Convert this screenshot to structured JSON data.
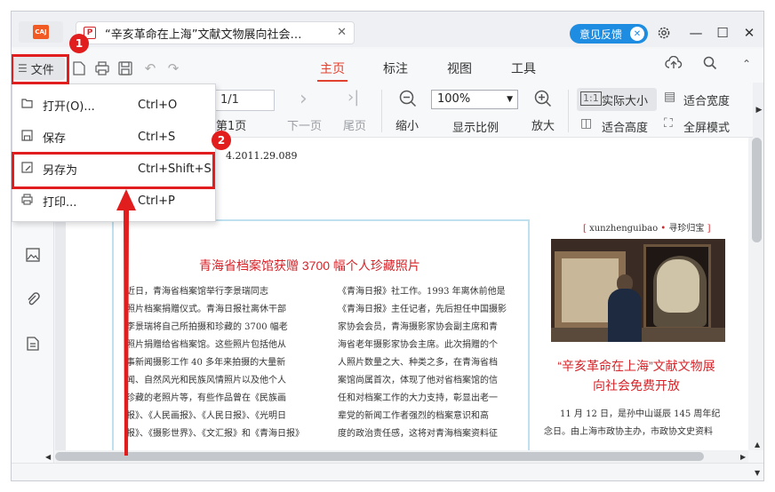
{
  "app": {
    "logo_text": "CAJ",
    "tab_icon": "pdf-icon",
    "tab_title": "“辛亥革命在上海”文献文物展向社会…",
    "tab_close": "✕"
  },
  "titlebar": {
    "feedback": "意见反馈",
    "feedback_close": "✕",
    "settings_icon": "gear-icon",
    "minimize": "—",
    "maximize": "☐",
    "close": "✕"
  },
  "menubar": {
    "file_label": "文件",
    "tabs": [
      {
        "label": "主页",
        "active": true
      },
      {
        "label": "标注"
      },
      {
        "label": "视图"
      },
      {
        "label": "工具"
      }
    ],
    "right_icons": [
      "cloud-upload-icon",
      "search-icon",
      "chevron-up-icon"
    ]
  },
  "ribbon": {
    "page_input": "1/1",
    "first_page": "第1页",
    "next_page": "下一页",
    "last_page": "尾页",
    "zoom_out": "缩小",
    "zoom_value": "100%",
    "zoom_ratio": "显示比例",
    "zoom_in": "放大",
    "actual_size": "实际大小",
    "fit_width": "适合宽度",
    "fit_height": "适合高度",
    "fullscreen": "全屏模式"
  },
  "filemenu": {
    "items": [
      {
        "label": "打开(O)...",
        "shortcut": "Ctrl+O",
        "icon": "folder-open-icon"
      },
      {
        "label": "保存",
        "shortcut": "Ctrl+S",
        "icon": "save-icon"
      },
      {
        "label": "另存为",
        "shortcut": "Ctrl+Shift+S",
        "icon": "save-as-icon"
      },
      {
        "label": "打印...",
        "shortcut": "Ctrl+P",
        "icon": "printer-icon"
      }
    ]
  },
  "annotations": {
    "step1": "1",
    "step2": "2"
  },
  "document": {
    "ref": "4.2011.29.089",
    "header_latin": "xunzhenguibao",
    "header_dot": "•",
    "header_cn": "寻珍归宝",
    "header_open": "[",
    "header_close": "]",
    "article_title": "青海省档案馆获赠 3700 幅个人珍藏照片",
    "col1": [
      "近日，青海省档案馆举行李景瑞同志",
      "照片档案捐赠仪式。青海日报社离休干部",
      "李景瑞将自己所拍摄和珍藏的 3700 幅老",
      "照片捐赠给省档案馆。这些照片包括他从",
      "事新闻摄影工作 40 多年来拍摄的大量新",
      "闻、自然风光和民族风情照片以及他个人",
      "珍藏的老照片等，有些作品曾在《民族画",
      "报》、《人民画报》、《人民日报》、《光明日",
      "报》、《摄影世界》、《文汇报》和《青海日报》"
    ],
    "col2": [
      "《青海日报》社工作。1993 年离休前他是",
      "《青海日报》主任记者，先后担任中国摄影",
      "家协会会员，青海摄影家协会副主席和青",
      "海省老年摄影家协会主席。此次捐赠的个",
      "人照片数量之大、种类之多，在青海省档",
      "案馆尚属首次，体现了他对省档案馆的信",
      "任和对档案工作的大力支持，彰显出老一",
      "辈党的新闻工作者强烈的档案意识和高",
      "度的政治责任感，这将对青海档案资料征"
    ],
    "side_title_1": "“辛亥革命在上海”文献文物展",
    "side_title_2": "向社会免费开放",
    "col3": [
      "11 月 12 日，是孙中山诞辰 145 周年纪",
      "念日。由上海市政协主办，市政协文史资料"
    ]
  }
}
